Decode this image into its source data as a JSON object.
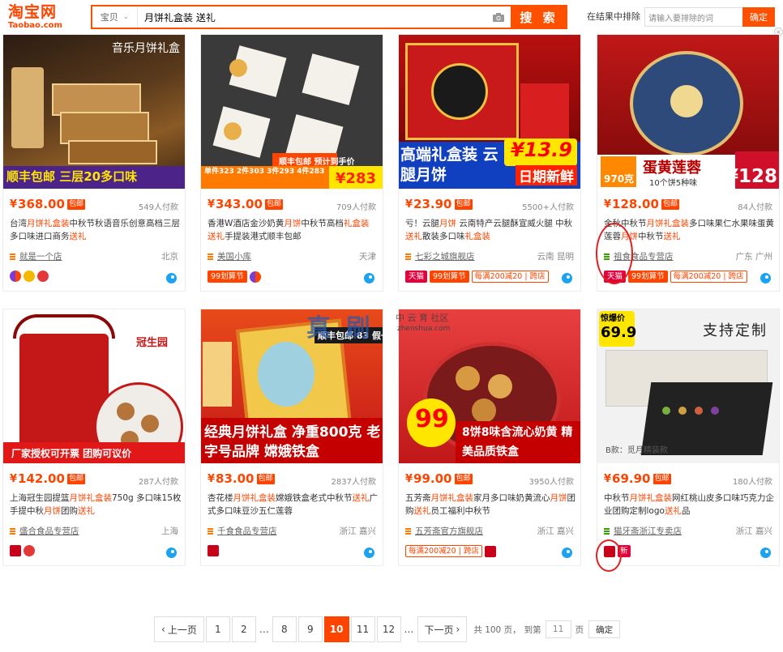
{
  "logo": {
    "cn": "淘宝网",
    "en": "Taobao.com"
  },
  "search": {
    "category": "宝贝",
    "query": "月饼礼盒装 送礼",
    "button": "搜 索"
  },
  "exclude": {
    "label": "在结果中排除",
    "placeholder": "请输入要排除的词",
    "button": "确定"
  },
  "products": [
    {
      "price": "368.00",
      "tag": "包邮",
      "sales": "549人付款",
      "title": [
        "台湾",
        "月饼礼盒",
        "装",
        "中秋节秋语音乐创意高档三层多口味进口商务",
        "送礼"
      ],
      "shop": "就是一个店",
      "location": "北京",
      "overlay_top": "音乐月饼礼盒",
      "overlay_bottom": "顺丰包邮  三层20多口味"
    },
    {
      "price": "343.00",
      "tag": "包邮",
      "sales": "709人付款",
      "title": [
        "香港W酒店金沙奶黄",
        "月饼",
        "中秋节高档",
        "礼盒装",
        "",
        "送礼",
        "手提装港式顺丰包邮"
      ],
      "shop": "美国小库",
      "location": "天津",
      "overlay_top": "顺丰包邮  预计到手价",
      "overlay_bottom": "单件323 2件303 3件293 4件283",
      "overlay_price": "283"
    },
    {
      "price": "23.90",
      "tag": "包邮",
      "sales": "5500+人付款",
      "title": [
        "亏！云腿",
        "月饼",
        " 云南特产云腿酥宣威火腿 中秋",
        "送礼",
        "散装多口味",
        "礼盒装"
      ],
      "shop": "七彩之城旗舰店",
      "location": "云南 昆明",
      "overlay_bottom": "高端礼盒装  云腿月饼",
      "overlay_price": "13.9",
      "overlay_sub": "日期新鲜"
    },
    {
      "price": "128.00",
      "tag": "包邮",
      "sales": "84人付款",
      "title": [
        "金秋中秋节",
        "月饼礼盒装",
        "多口味果仁水果味蛋黄莲蓉",
        "月饼",
        "中秋节",
        "送礼"
      ],
      "shop": "祖食食品专营店",
      "location": "广东 广州",
      "overlay_bottom": "蛋黄莲蓉",
      "overlay_sub": "10个饼5种味",
      "overlay_price": "128",
      "overlay_weight": "970克"
    },
    {
      "price": "142.00",
      "tag": "包邮",
      "sales": "287人付款",
      "title": [
        "上海冠生园提篮",
        "月饼礼盒装",
        "750g 多口味15枚手提中秋",
        "月饼",
        "团购",
        "送礼"
      ],
      "shop": "盛合食品专营店",
      "location": "上海",
      "overlay_bottom": "厂家授权可开票  团购可议价",
      "overlay_top": "冠生园"
    },
    {
      "price": "83.00",
      "tag": "包邮",
      "sales": "2837人付款",
      "title": [
        "杏花楼",
        "月饼礼盒装",
        "嫦娥铁盒老式中秋节",
        "送礼",
        "广式多口味豆沙五仁莲蓉"
      ],
      "shop": "千食食品专营店",
      "location": "浙江 嘉兴",
      "overlay_top": "顺丰包邮  83 假一赔十",
      "overlay_bottom": "经典月饼礼盒 净重800克  老字号品牌 嫦娥铁盒"
    },
    {
      "price": "99.00",
      "tag": "包邮",
      "sales": "3950人付款",
      "title": [
        "五芳斋",
        "月饼礼盒装",
        "家月多口味奶黄流心",
        "月饼",
        "团购",
        "送礼",
        "员工福利中秋节"
      ],
      "shop": "五芳斋官方旗舰店",
      "location": "浙江 嘉兴",
      "overlay_bottom": "8饼8味含流心奶黄  精美品质铁盒",
      "overlay_price": "99"
    },
    {
      "price": "69.90",
      "tag": "包邮",
      "sales": "180人付款",
      "title": [
        "中秋节",
        "月饼礼盒装",
        "网红桃山皮多口味巧克力企业团购定制logo",
        "送礼",
        "品"
      ],
      "shop": "猫牙斋浙江专卖店",
      "location": "浙江 嘉兴",
      "overlay_top": "支持定制",
      "overlay_price": "69.9",
      "overlay_tag": "惊爆价",
      "overlay_sub": "B款：觅月精装款"
    }
  ],
  "badges": {
    "tmall": "天猫",
    "juhuasuan": "99划算节",
    "discount": "每满200减20",
    "cross": "跨店",
    "new": "新"
  },
  "watermark": {
    "cn": "真 刷",
    "site": "zhenshua.com",
    "sub": "中 云 育 社区"
  },
  "pager": {
    "prev": "上一页",
    "pages": [
      "1",
      "2",
      "…",
      "8",
      "9",
      "10",
      "11",
      "12",
      "…"
    ],
    "current": "10",
    "next": "下一页",
    "total": "共 100 页，",
    "goto": "到第",
    "goto_value": "11",
    "page_unit": "页",
    "confirm": "确定"
  }
}
